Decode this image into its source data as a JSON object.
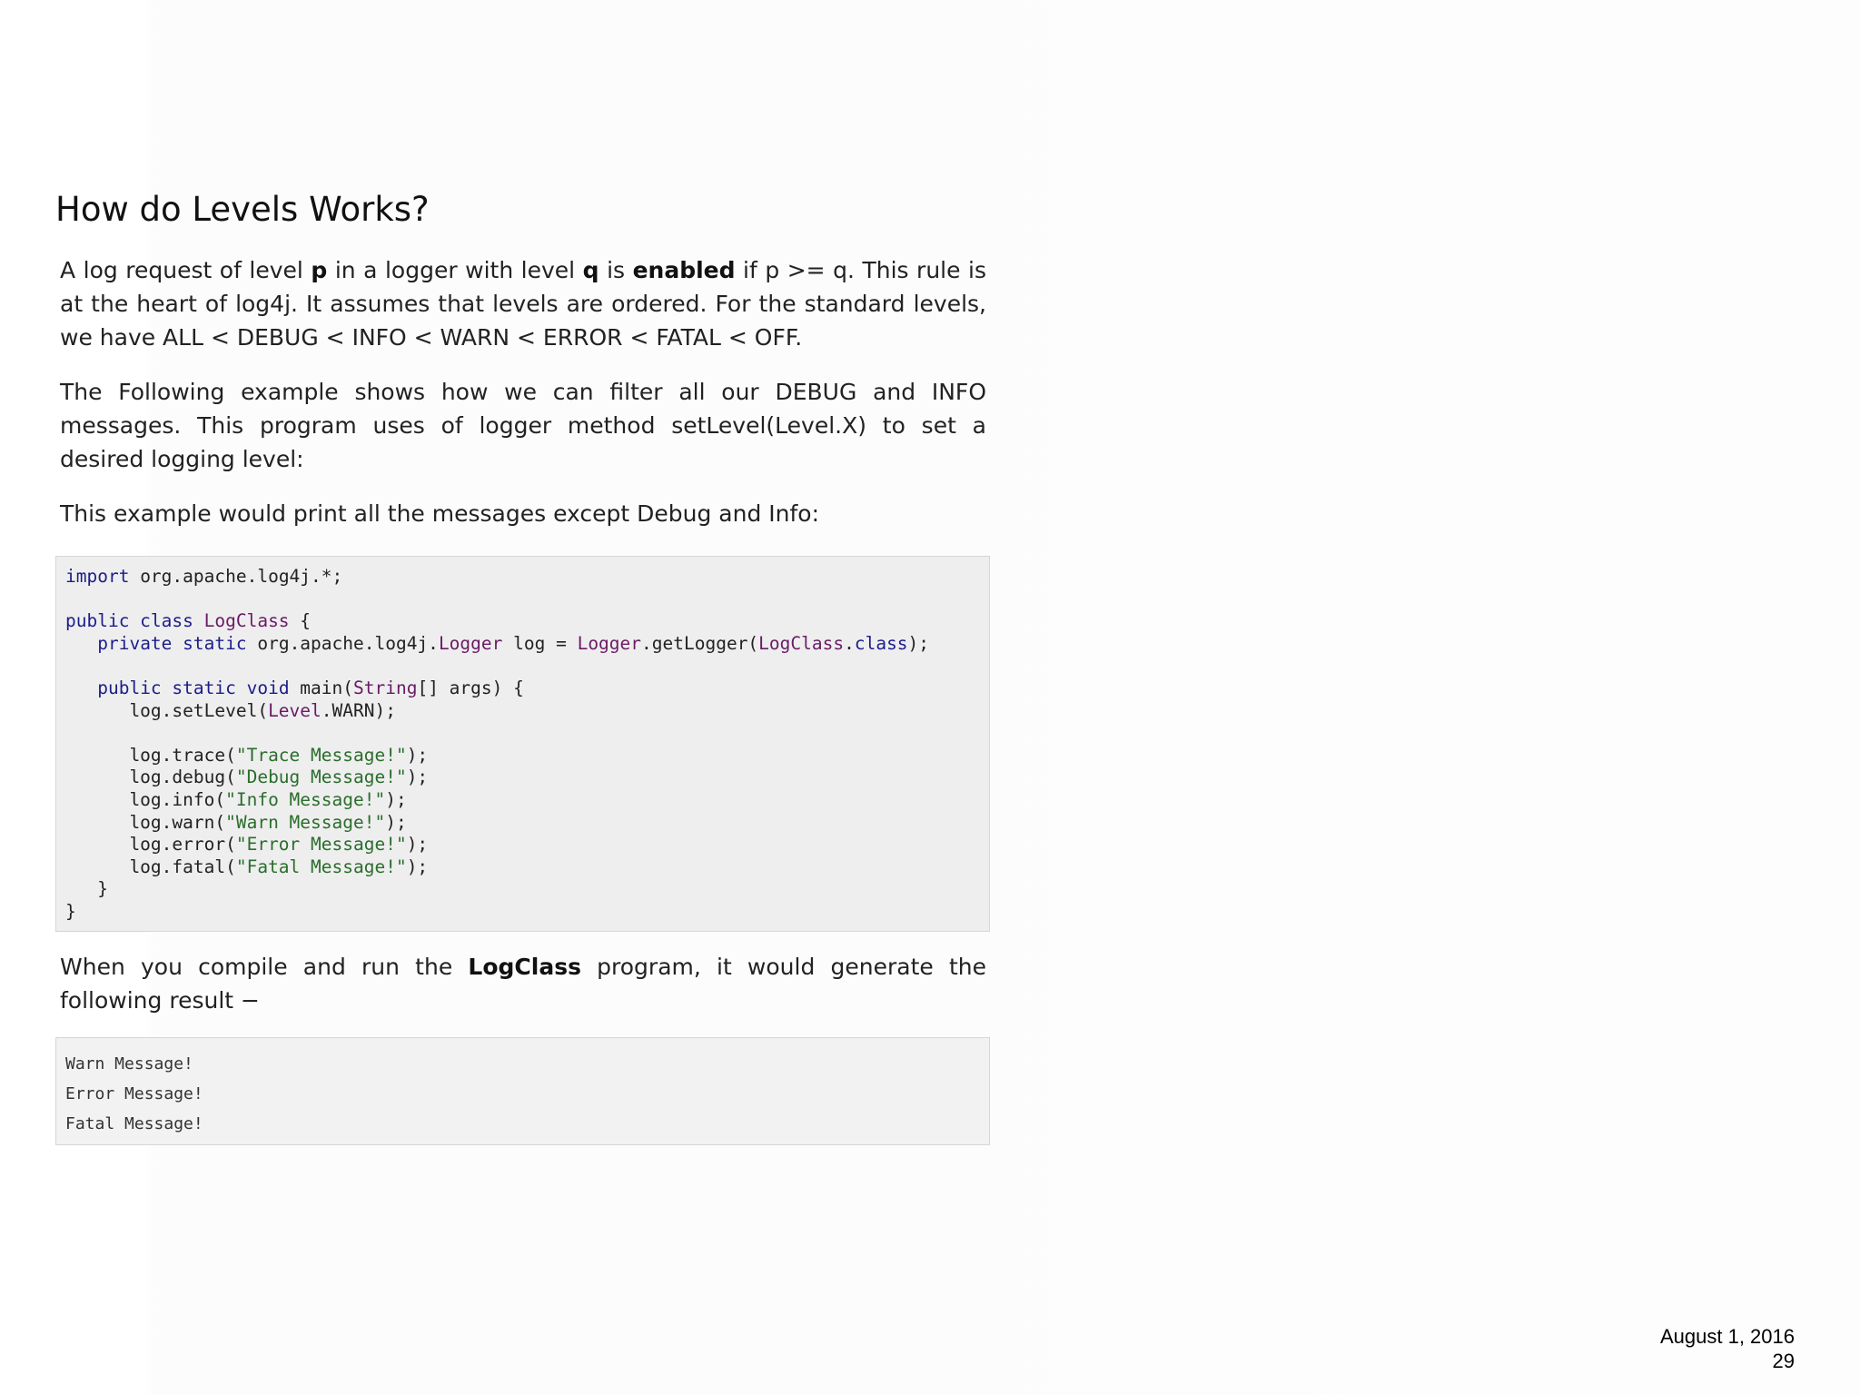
{
  "heading": "How do Levels Works?",
  "para1": {
    "t1": "A log request of level ",
    "b1": "p",
    "t2": " in a logger with level ",
    "b2": "q",
    "t3": " is ",
    "b3": "enabled",
    "t4": " if p >= q. This rule is at the heart of log4j. It assumes that levels are ordered. For the standard levels, we have ALL < DEBUG < INFO < WARN < ERROR < FATAL < OFF."
  },
  "para2": "The Following example shows how we can filter all our DEBUG and INFO messages. This program uses of logger method setLevel(Level.X) to set a desired logging level:",
  "para3": "This example would print all the messages except Debug and Info:",
  "code": [
    [
      [
        "kw",
        "import"
      ],
      [
        "pln",
        " org.apache.log4j.*;"
      ]
    ],
    [],
    [
      [
        "kw",
        "public class "
      ],
      [
        "typ",
        "LogClass"
      ],
      [
        "pln",
        " {"
      ]
    ],
    [
      [
        "pln",
        "   "
      ],
      [
        "kw",
        "private static "
      ],
      [
        "pln",
        "org.apache.log4j."
      ],
      [
        "typ",
        "Logger"
      ],
      [
        "pln",
        " log = "
      ],
      [
        "typ",
        "Logger"
      ],
      [
        "pln",
        ".getLogger("
      ],
      [
        "typ",
        "LogClass"
      ],
      [
        "pln",
        "."
      ],
      [
        "kw",
        "class"
      ],
      [
        "pln",
        ");"
      ]
    ],
    [],
    [
      [
        "pln",
        "   "
      ],
      [
        "kw",
        "public static void "
      ],
      [
        "pln",
        "main("
      ],
      [
        "typ",
        "String"
      ],
      [
        "pln",
        "[] args) {"
      ]
    ],
    [
      [
        "pln",
        "      log.setLevel("
      ],
      [
        "typ",
        "Level"
      ],
      [
        "pln",
        ".WARN);"
      ]
    ],
    [],
    [
      [
        "pln",
        "      log.trace("
      ],
      [
        "str",
        "\"Trace Message!\""
      ],
      [
        "pln",
        ");"
      ]
    ],
    [
      [
        "pln",
        "      log.debug("
      ],
      [
        "str",
        "\"Debug Message!\""
      ],
      [
        "pln",
        ");"
      ]
    ],
    [
      [
        "pln",
        "      log.info("
      ],
      [
        "str",
        "\"Info Message!\""
      ],
      [
        "pln",
        ");"
      ]
    ],
    [
      [
        "pln",
        "      log.warn("
      ],
      [
        "str",
        "\"Warn Message!\""
      ],
      [
        "pln",
        ");"
      ]
    ],
    [
      [
        "pln",
        "      log.error("
      ],
      [
        "str",
        "\"Error Message!\""
      ],
      [
        "pln",
        ");"
      ]
    ],
    [
      [
        "pln",
        "      log.fatal("
      ],
      [
        "str",
        "\"Fatal Message!\""
      ],
      [
        "pln",
        ");"
      ]
    ],
    [
      [
        "pln",
        "   }"
      ]
    ],
    [
      [
        "pln",
        "}"
      ]
    ]
  ],
  "para4": {
    "t1": "When you compile and run the ",
    "b1": "LogClass",
    "t2": " program, it would generate the following result −"
  },
  "output": [
    "Warn Message!",
    "Error Message!",
    "Fatal Message!"
  ],
  "footer": {
    "date": "August 1, 2016",
    "page": "29"
  }
}
